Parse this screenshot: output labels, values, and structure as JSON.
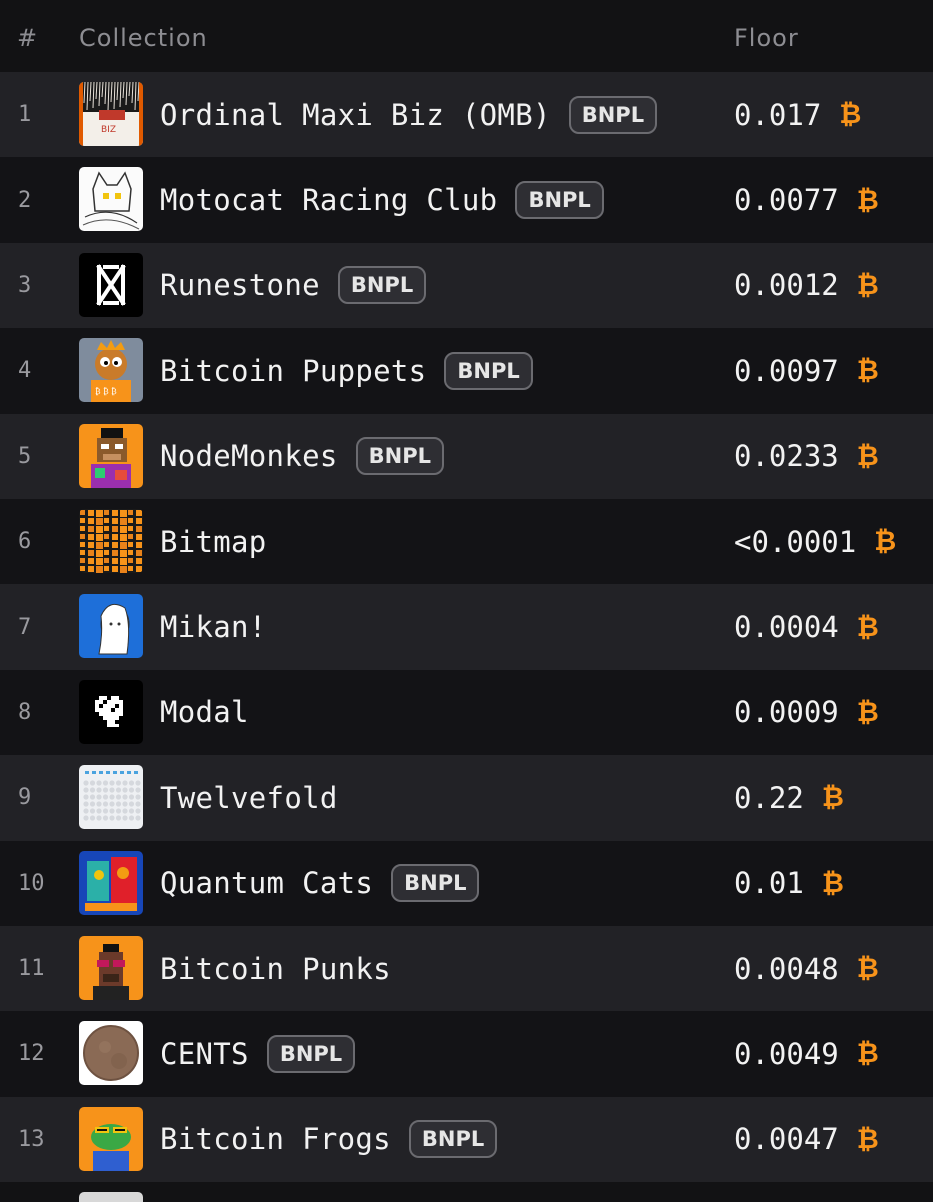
{
  "header": {
    "num": "#",
    "collection": "Collection",
    "floor": "Floor"
  },
  "badge_label": "BNPL",
  "btc_symbol": "₿",
  "colors": {
    "accent_btc": "#f7931a",
    "row_odd": "#222226",
    "row_even": "#131316"
  },
  "rows": [
    {
      "rank": "1",
      "name": "Ordinal Maxi Biz (OMB)",
      "bnpl": true,
      "floor": "0.017",
      "thumb": "omb-thumbnail"
    },
    {
      "rank": "2",
      "name": "Motocat Racing Club",
      "bnpl": true,
      "floor": "0.0077",
      "thumb": "motocat-thumbnail"
    },
    {
      "rank": "3",
      "name": "Runestone",
      "bnpl": true,
      "floor": "0.0012",
      "thumb": "runestone-thumbnail"
    },
    {
      "rank": "4",
      "name": "Bitcoin Puppets",
      "bnpl": true,
      "floor": "0.0097",
      "thumb": "puppets-thumbnail"
    },
    {
      "rank": "5",
      "name": "NodeMonkes",
      "bnpl": true,
      "floor": "0.0233",
      "thumb": "nodemonkes-thumbnail"
    },
    {
      "rank": "6",
      "name": "Bitmap",
      "bnpl": false,
      "floor": "<0.0001",
      "thumb": "bitmap-thumbnail"
    },
    {
      "rank": "7",
      "name": "Mikan!",
      "bnpl": false,
      "floor": "0.0004",
      "thumb": "mikan-thumbnail"
    },
    {
      "rank": "8",
      "name": "Modal",
      "bnpl": false,
      "floor": "0.0009",
      "thumb": "modal-thumbnail"
    },
    {
      "rank": "9",
      "name": "Twelvefold",
      "bnpl": false,
      "floor": "0.22",
      "thumb": "twelvefold-thumbnail"
    },
    {
      "rank": "10",
      "name": "Quantum Cats",
      "bnpl": true,
      "floor": "0.01",
      "thumb": "quantum-cats-thumbnail"
    },
    {
      "rank": "11",
      "name": "Bitcoin Punks",
      "bnpl": false,
      "floor": "0.0048",
      "thumb": "punks-thumbnail"
    },
    {
      "rank": "12",
      "name": "CENTS",
      "bnpl": true,
      "floor": "0.0049",
      "thumb": "cents-thumbnail"
    },
    {
      "rank": "13",
      "name": "Bitcoin Frogs",
      "bnpl": true,
      "floor": "0.0047",
      "thumb": "frogs-thumbnail"
    }
  ]
}
